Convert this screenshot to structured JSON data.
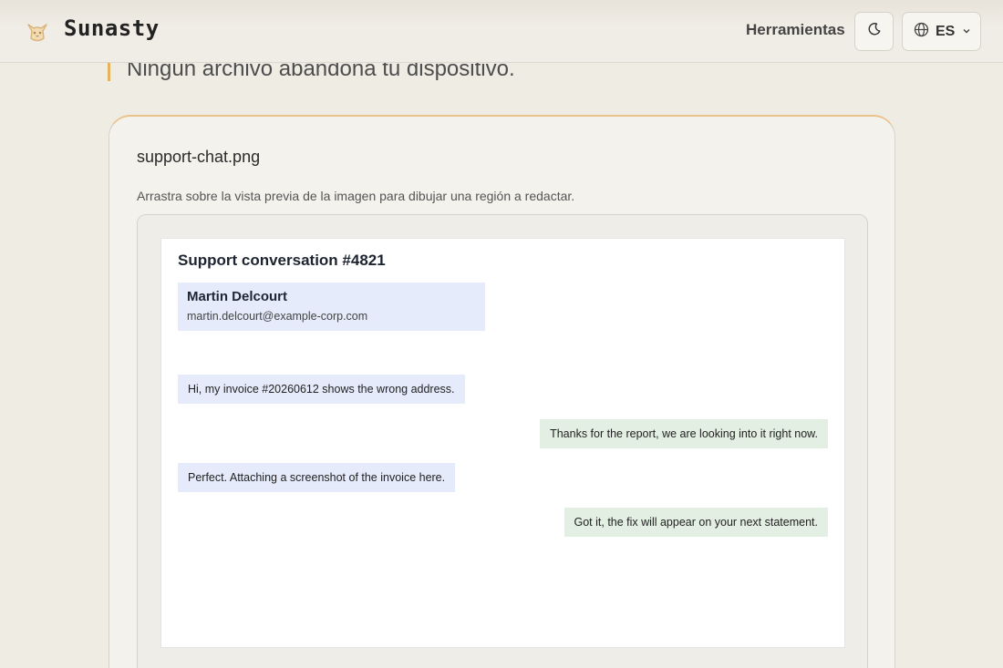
{
  "header": {
    "brand": "Sunasty",
    "nav_tools": "Herramientas",
    "language_code": "ES",
    "logo_icon": "cat-face-icon",
    "theme_icon": "moon-icon",
    "language_icon": "globe-icon",
    "dropdown_icon": "chevron-down-icon"
  },
  "intro": {
    "tagline": "Ningún archivo abandona tu dispositivo."
  },
  "editor": {
    "filename": "support-chat.png",
    "hint": "Arrastra sobre la vista previa de la imagen para dibujar una región a redactar.",
    "preview": {
      "title": "Support conversation #4821",
      "contact_name": "Martin Delcourt",
      "contact_email": "martin.delcourt@example-corp.com",
      "messages": [
        {
          "side": "in",
          "text": "Hi, my invoice #20260612 shows the wrong address."
        },
        {
          "side": "out",
          "text": "Thanks for the report, we are looking into it right now."
        },
        {
          "side": "in",
          "text": "Perfect. Attaching a screenshot of the invoice here."
        },
        {
          "side": "out",
          "text": "Got it, the fix will appear on your next statement."
        }
      ]
    }
  },
  "colors": {
    "accent": "#e6b25c",
    "incoming_bubble": "#e6ebfb",
    "outgoing_bubble": "#e3efe3"
  }
}
